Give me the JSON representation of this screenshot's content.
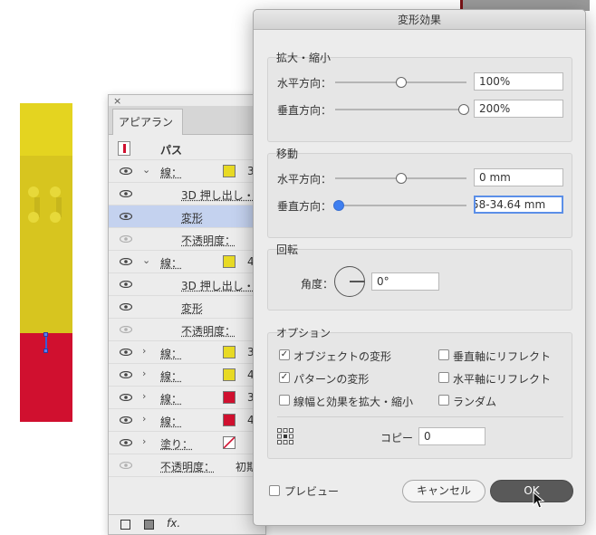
{
  "dialog": {
    "title": "変形効果",
    "scale": {
      "heading": "拡大・縮小",
      "horizontal_label": "水平方向：",
      "horizontal_value": "100%",
      "vertical_label": "垂直方向：",
      "vertical_value": "200%"
    },
    "move": {
      "heading": "移動",
      "horizontal_label": "水平方向：",
      "horizontal_value": "0 mm",
      "vertical_label": "垂直方向：",
      "vertical_value": "58-34.64 mm"
    },
    "rotate": {
      "heading": "回転",
      "angle_label": "角度：",
      "angle_value": "0°"
    },
    "options": {
      "heading": "オプション",
      "transform_objects": {
        "label": "オブジェクトの変形",
        "checked": true
      },
      "transform_patterns": {
        "label": "パターンの変形",
        "checked": true
      },
      "scale_strokes": {
        "label": "線幅と効果を拡大・縮小",
        "checked": false
      },
      "reflect_x": {
        "label": "垂直軸にリフレクト",
        "checked": false
      },
      "reflect_y": {
        "label": "水平軸にリフレクト",
        "checked": false
      },
      "random": {
        "label": "ランダム",
        "checked": false
      },
      "copies_label": "コピー",
      "copies_value": "0"
    },
    "preview_label": "プレビュー",
    "cancel_label": "キャンセル",
    "ok_label": "OK"
  },
  "appearance_panel": {
    "close_glyph": "×",
    "tab_label": "アピアランス",
    "header_label": "パス",
    "rows": [
      {
        "label": "線：",
        "trunc": "3",
        "swatch": "#e8da24"
      },
      {
        "label": "3D 押し出し・"
      },
      {
        "label": "変形"
      },
      {
        "label": "不透明度："
      },
      {
        "label": "線：",
        "trunc": "4",
        "swatch": "#e8da24"
      },
      {
        "label": "3D 押し出し・"
      },
      {
        "label": "変形"
      },
      {
        "label": "不透明度："
      },
      {
        "label": "線：",
        "trunc": "3",
        "swatch": "#e8da24"
      },
      {
        "label": "線：",
        "trunc": "4",
        "swatch": "#e8da24"
      },
      {
        "label": "線：",
        "trunc": "3",
        "swatch": "#d0102f"
      },
      {
        "label": "線：",
        "trunc": "4",
        "swatch": "#d0102f"
      },
      {
        "label": "塗り："
      },
      {
        "label": "不透明度：",
        "trunc": "初期"
      }
    ],
    "footer_fx": "fx."
  },
  "colors": {
    "art_yellow": "#e4d420",
    "art_red": "#d0102f",
    "selected_row": "#c4d2ef",
    "ok_button": "#595959"
  }
}
